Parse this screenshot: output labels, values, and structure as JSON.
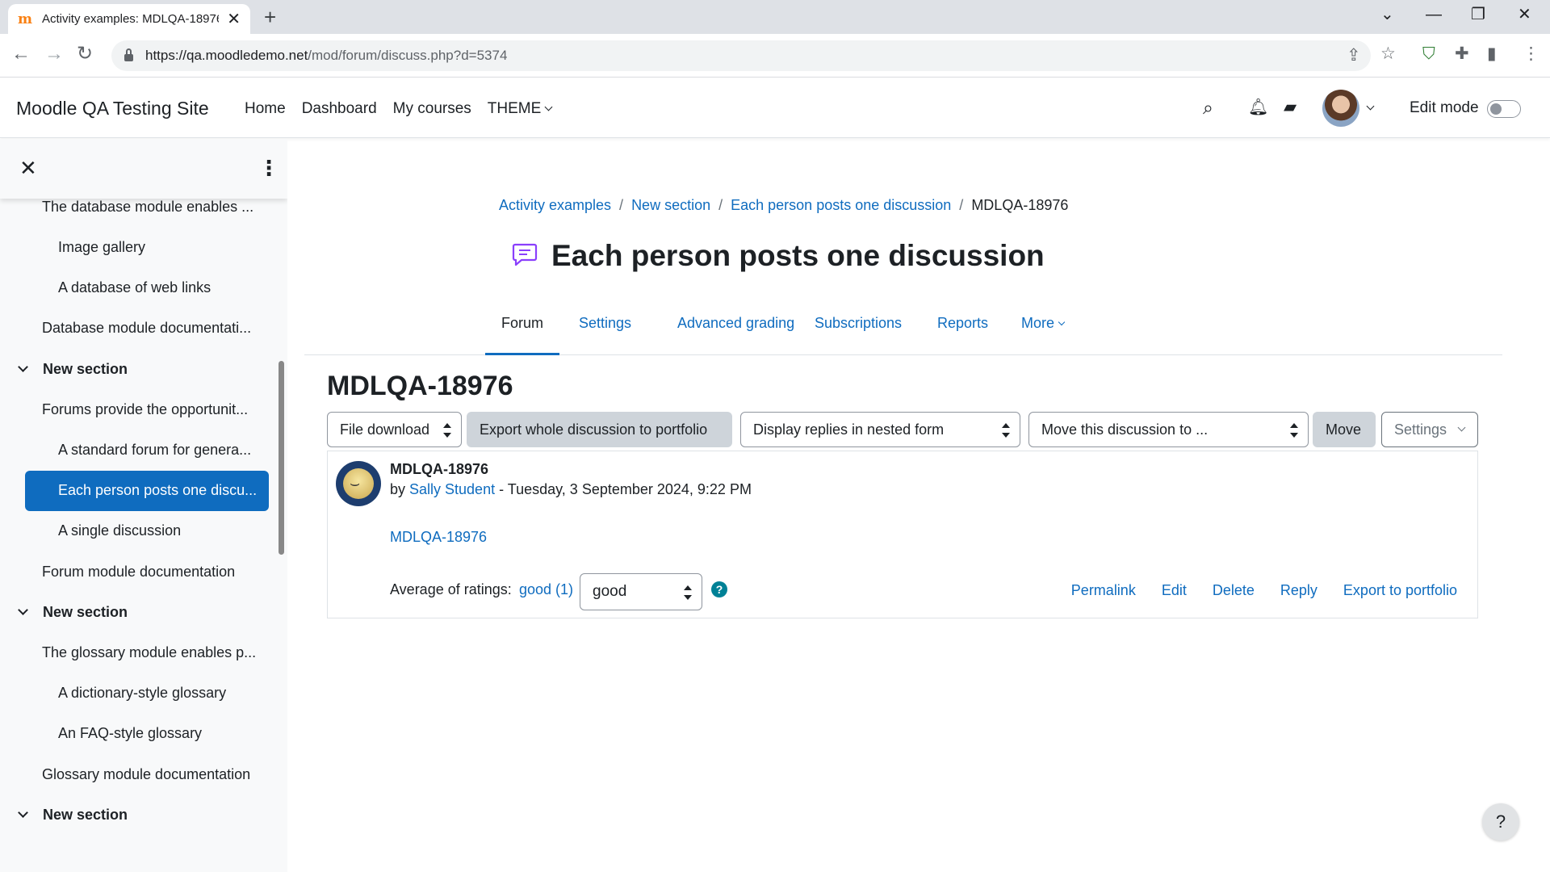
{
  "browser": {
    "tab_title": "Activity examples: MDLQA-18976",
    "url_host": "https://qa.moodledemo.net",
    "url_path": "/mod/forum/discuss.php?d=5374"
  },
  "header": {
    "site_name": "Moodle QA Testing Site",
    "nav": [
      "Home",
      "Dashboard",
      "My courses",
      "THEME"
    ],
    "edit_mode_label": "Edit mode"
  },
  "course_index": [
    {
      "label": "New section",
      "type": "section"
    },
    {
      "label": "The database module enables ...",
      "type": "item"
    },
    {
      "label": "Image gallery",
      "type": "sub"
    },
    {
      "label": "A database of web links",
      "type": "sub"
    },
    {
      "label": "Database module documentati...",
      "type": "item"
    },
    {
      "label": "New section",
      "type": "section"
    },
    {
      "label": "Forums provide the opportunit...",
      "type": "item"
    },
    {
      "label": "A standard forum for genera...",
      "type": "sub"
    },
    {
      "label": "Each person posts one discu...",
      "type": "sub",
      "active": true
    },
    {
      "label": "A single discussion",
      "type": "sub"
    },
    {
      "label": "Forum module documentation",
      "type": "item"
    },
    {
      "label": "New section",
      "type": "section"
    },
    {
      "label": "The glossary module enables p...",
      "type": "item"
    },
    {
      "label": "A dictionary-style glossary",
      "type": "sub"
    },
    {
      "label": "An FAQ-style glossary",
      "type": "sub"
    },
    {
      "label": "Glossary module documentation",
      "type": "item"
    },
    {
      "label": "New section",
      "type": "section"
    }
  ],
  "breadcrumb": [
    "Activity examples",
    "New section",
    "Each person posts one discussion",
    "MDLQA-18976"
  ],
  "page_title": "Each person posts one discussion",
  "secondary_nav": [
    "Forum",
    "Settings",
    "Advanced grading",
    "Subscriptions",
    "Reports",
    "More"
  ],
  "discussion": {
    "title": "MDLQA-18976",
    "controls": {
      "file_download": "File download",
      "export_portfolio": "Export whole discussion to portfolio",
      "display_mode": "Display replies in nested form",
      "move_to": "Move this discussion to ...",
      "move": "Move",
      "settings": "Settings"
    },
    "post": {
      "subject": "MDLQA-18976",
      "by": "by ",
      "author": "Sally Student",
      "date": " - Tuesday, 3 September 2024, 9:22 PM",
      "body_link": "MDLQA-18976",
      "rating_label": "Average of ratings:",
      "rating_value": "good (1)",
      "rating_select": "good",
      "actions": [
        "Permalink",
        "Edit",
        "Delete",
        "Reply",
        "Export to portfolio"
      ]
    }
  },
  "help_button": "?"
}
